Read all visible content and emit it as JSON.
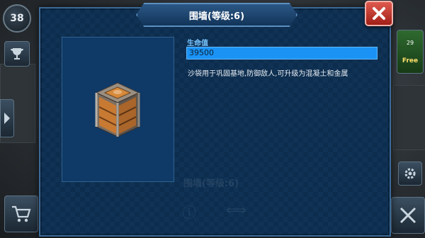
{
  "hud": {
    "player_level": "38",
    "free_badge": "Free",
    "gem_count": "29"
  },
  "dialog": {
    "title": "围墙(等级:6)",
    "stat_label": "生命值",
    "stat_value": "39500",
    "stat_fill_fraction": 1.0,
    "description": "沙袋用于巩固基地,防御敌人,可升级为混凝土和金属",
    "ghost_title": "围墙(等级:6)"
  },
  "icons": {
    "close": "close-x-icon",
    "trophy": "trophy-icon",
    "arrow": "arrow-right-icon",
    "cart": "shopping-cart-icon",
    "gear": "gear-icon",
    "crossed_swords": "crossed-swords-icon",
    "wall_block": "sandbag-wall-block-icon"
  },
  "colors": {
    "dialog_bg": "#0d2d4f",
    "stat_bar": "#1b93f5",
    "close_button": "#c0342a",
    "label_blue": "#79c6ff"
  }
}
